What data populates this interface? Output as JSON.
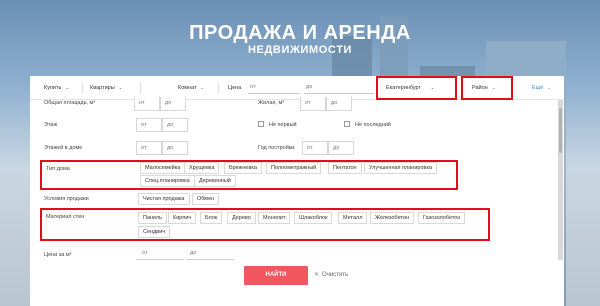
{
  "hero": {
    "title": "ПРОДАЖА И АРЕНДА",
    "subtitle": "НЕДВИЖИМОСТИ"
  },
  "search_bar": {
    "deal": "Купить",
    "property": "Квартиры",
    "rooms": "Комнат",
    "price_label": "Цена",
    "price_from": "от",
    "price_to": "до",
    "city": "Екатеринбург",
    "district": "Район",
    "more": "Ещё"
  },
  "filters": {
    "total_area_label": "Общая площадь, м²",
    "living_area_label": "Жилая, м²",
    "from": "от",
    "to": "до",
    "floor_label": "Этаж",
    "not_first": "Не первый",
    "not_last": "Не последний",
    "floors_label": "Этажей в доме",
    "year_label": "Год постройки",
    "house_type_label": "Тип дома",
    "house_types": [
      "Малосемейка",
      "Хрущевка",
      "Брежневка",
      "Полнометражный",
      "Пентагон",
      "Улучшенная планировка",
      "Спец.планировка",
      "Деревянный"
    ],
    "sale_conditions_label": "Условия продажи",
    "sale_conditions": [
      "Чистая продажа",
      "Обмен"
    ],
    "wall_material_label": "Материал стен",
    "wall_materials": [
      "Панель",
      "Кирпич",
      "Блок",
      "Дерево",
      "Монолит",
      "Шлакоблок",
      "Металл",
      "Железобетон",
      "Газозолобетон",
      "Сендвич"
    ],
    "price_per_m2_label": "Цена за м²"
  },
  "actions": {
    "find": "НАЙТИ",
    "clear": "Очистить"
  },
  "colors": {
    "accent": "#f2565f",
    "highlight": "#e20d1b"
  }
}
